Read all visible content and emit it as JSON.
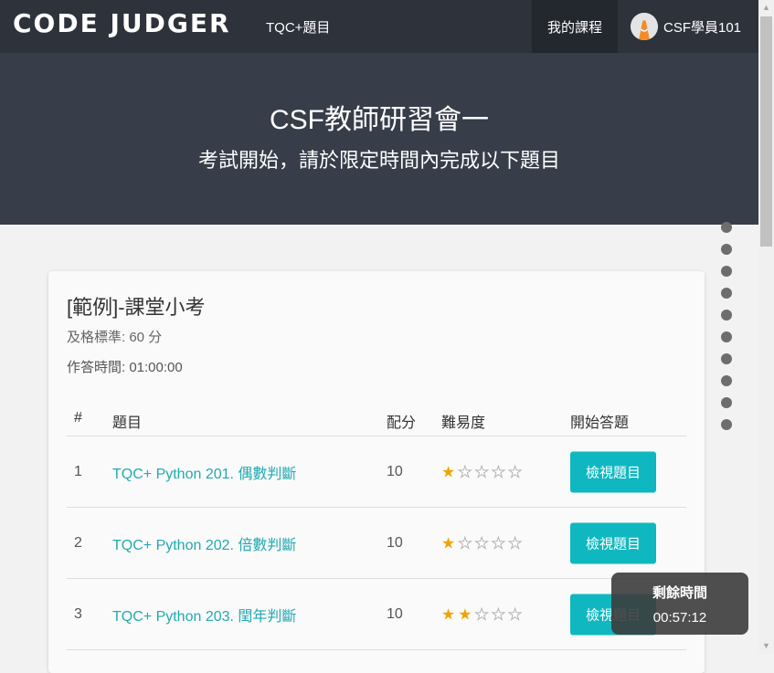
{
  "nav": {
    "brand": "CODE JUDGER",
    "link": "TQC+題目",
    "my_courses": "我的課程",
    "user": "CSF學員101",
    "avatar_icon": "user-avatar-icon"
  },
  "hero": {
    "title": "CSF教師研習會一",
    "subtitle": "考試開始，請於限定時間內完成以下題目"
  },
  "exam": {
    "title": "[範例]-課堂小考",
    "pass_line": "及格標準:  60 分",
    "time_line": "作答時間: 01:00:00"
  },
  "table": {
    "headers": [
      "#",
      "題目",
      "配分",
      "難易度",
      "開始答題"
    ],
    "rows": [
      {
        "num": "1",
        "title": "TQC+ Python 201. 偶數判斷",
        "score": "10",
        "difficulty": 1,
        "button": "檢視題目"
      },
      {
        "num": "2",
        "title": "TQC+ Python 202. 倍數判斷",
        "score": "10",
        "difficulty": 1,
        "button": "檢視題目"
      },
      {
        "num": "3",
        "title": "TQC+ Python 203. 閏年判斷",
        "score": "10",
        "difficulty": 2,
        "button": "檢視題目"
      }
    ],
    "max_stars": 5
  },
  "timer": {
    "label": "剩餘時間",
    "value": "00:57:12"
  },
  "colors": {
    "navbar": "#2d323b",
    "hero": "#373d49",
    "accent": "#0fb8c0",
    "link": "#22a9b2",
    "star": "#f0a400"
  }
}
